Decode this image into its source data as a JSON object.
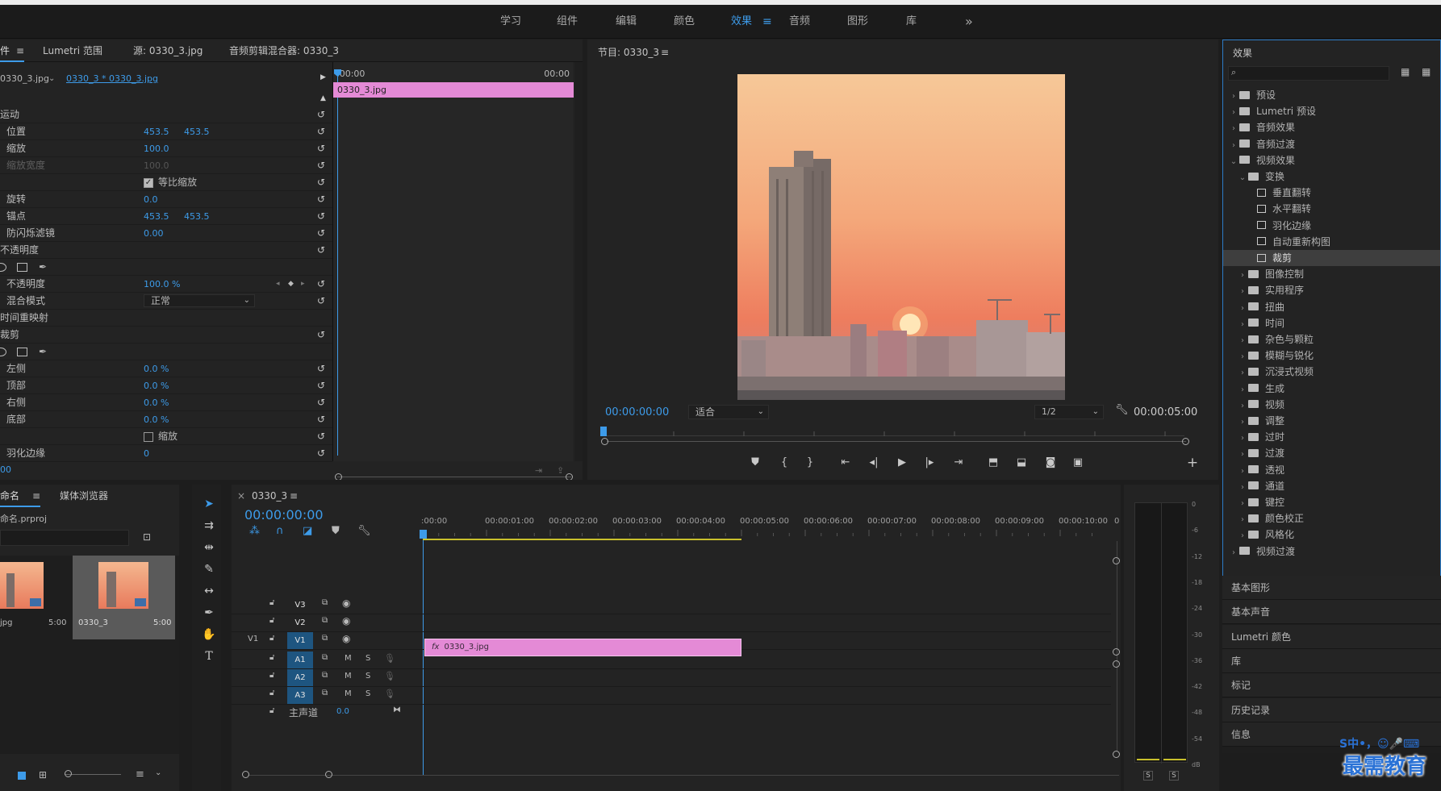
{
  "workspace_tabs": [
    {
      "label": "学习",
      "active": false
    },
    {
      "label": "组件",
      "active": false
    },
    {
      "label": "编辑",
      "active": false
    },
    {
      "label": "颜色",
      "active": false
    },
    {
      "label": "效果",
      "active": true
    },
    {
      "label": "音频",
      "active": false
    },
    {
      "label": "图形",
      "active": false
    },
    {
      "label": "库",
      "active": false
    }
  ],
  "workspace_more": "»",
  "effect_controls": {
    "tab_partial": "件",
    "tabs": [
      "Lumetri 范围",
      "源: 0330_3.jpg",
      "音频剪辑混合器: 0330_3"
    ],
    "source_clip": "0330_3.jpg",
    "sequence_clip": "0330_3 * 0330_3.jpg",
    "timecode_start": ":00:00",
    "timecode_end": "00:00",
    "clip_bar_label": "0330_3.jpg",
    "bottom_timecode": "00",
    "rows": [
      {
        "label": "运动",
        "v1": "",
        "v2": "",
        "indent": 0
      },
      {
        "label": "位置",
        "v1": "453.5",
        "v2": "453.5",
        "indent": 1
      },
      {
        "label": "缩放",
        "v1": "100.0",
        "v2": "",
        "indent": 1
      },
      {
        "label": "缩放宽度",
        "v1": "100.0",
        "v2": "",
        "indent": 1,
        "dim": true
      },
      {
        "label": "",
        "v1": "",
        "v2": "",
        "indent": 1,
        "checkbox": "等比缩放",
        "checked": true
      },
      {
        "label": "旋转",
        "v1": "0.0",
        "v2": "",
        "indent": 1
      },
      {
        "label": "锚点",
        "v1": "453.5",
        "v2": "453.5",
        "indent": 1
      },
      {
        "label": "防闪烁滤镜",
        "v1": "0.00",
        "v2": "",
        "indent": 1
      },
      {
        "label": "不透明度",
        "v1": "",
        "v2": "",
        "indent": 0
      },
      {
        "label": "",
        "v1": "",
        "v2": "",
        "indent": 0,
        "shapes": true
      },
      {
        "label": "不透明度",
        "v1": "100.0 %",
        "v2": "",
        "indent": 1,
        "keyframe": true
      },
      {
        "label": "混合模式",
        "v1": "",
        "v2": "",
        "indent": 1,
        "select": "正常"
      },
      {
        "label": "时间重映射",
        "v1": "",
        "v2": "",
        "indent": 0
      },
      {
        "label": "裁剪",
        "v1": "",
        "v2": "",
        "indent": 0
      },
      {
        "label": "",
        "v1": "",
        "v2": "",
        "indent": 0,
        "shapes": true
      },
      {
        "label": "左侧",
        "v1": "0.0 %",
        "v2": "",
        "indent": 1
      },
      {
        "label": "顶部",
        "v1": "0.0 %",
        "v2": "",
        "indent": 1
      },
      {
        "label": "右侧",
        "v1": "0.0 %",
        "v2": "",
        "indent": 1
      },
      {
        "label": "底部",
        "v1": "0.0 %",
        "v2": "",
        "indent": 1
      },
      {
        "label": "",
        "v1": "",
        "v2": "",
        "indent": 1,
        "checkbox": "缩放",
        "checked": false
      },
      {
        "label": "羽化边缘",
        "v1": "0",
        "v2": "",
        "indent": 1
      }
    ]
  },
  "program_monitor": {
    "title": "节目: 0330_3",
    "timecode": "00:00:00:00",
    "fit": "适合",
    "quality": "1/2",
    "duration": "00:00:05:00"
  },
  "effects_panel": {
    "title": "效果",
    "search_placeholder": "",
    "items": [
      {
        "label": "预设",
        "level": 0,
        "type": "folder",
        "open": false
      },
      {
        "label": "Lumetri 预设",
        "level": 0,
        "type": "folder",
        "open": false
      },
      {
        "label": "音频效果",
        "level": 0,
        "type": "folder",
        "open": false
      },
      {
        "label": "音频过渡",
        "level": 0,
        "type": "folder",
        "open": false
      },
      {
        "label": "视频效果",
        "level": 0,
        "type": "folder",
        "open": true
      },
      {
        "label": "变换",
        "level": 1,
        "type": "folder",
        "open": true
      },
      {
        "label": "垂直翻转",
        "level": 2,
        "type": "effect"
      },
      {
        "label": "水平翻转",
        "level": 2,
        "type": "effect"
      },
      {
        "label": "羽化边缘",
        "level": 2,
        "type": "effect"
      },
      {
        "label": "自动重新构图",
        "level": 2,
        "type": "effect"
      },
      {
        "label": "裁剪",
        "level": 2,
        "type": "effect",
        "selected": true
      },
      {
        "label": "图像控制",
        "level": 1,
        "type": "folder",
        "open": false
      },
      {
        "label": "实用程序",
        "level": 1,
        "type": "folder",
        "open": false
      },
      {
        "label": "扭曲",
        "level": 1,
        "type": "folder",
        "open": false
      },
      {
        "label": "时间",
        "level": 1,
        "type": "folder",
        "open": false
      },
      {
        "label": "杂色与颗粒",
        "level": 1,
        "type": "folder",
        "open": false
      },
      {
        "label": "模糊与锐化",
        "level": 1,
        "type": "folder",
        "open": false
      },
      {
        "label": "沉浸式视频",
        "level": 1,
        "type": "folder",
        "open": false
      },
      {
        "label": "生成",
        "level": 1,
        "type": "folder",
        "open": false
      },
      {
        "label": "视频",
        "level": 1,
        "type": "folder",
        "open": false
      },
      {
        "label": "调整",
        "level": 1,
        "type": "folder",
        "open": false
      },
      {
        "label": "过时",
        "level": 1,
        "type": "folder",
        "open": false
      },
      {
        "label": "过渡",
        "level": 1,
        "type": "folder",
        "open": false
      },
      {
        "label": "透视",
        "level": 1,
        "type": "folder",
        "open": false
      },
      {
        "label": "通道",
        "level": 1,
        "type": "folder",
        "open": false
      },
      {
        "label": "键控",
        "level": 1,
        "type": "folder",
        "open": false
      },
      {
        "label": "颜色校正",
        "level": 1,
        "type": "folder",
        "open": false
      },
      {
        "label": "风格化",
        "level": 1,
        "type": "folder",
        "open": false
      },
      {
        "label": "视频过渡",
        "level": 0,
        "type": "folder",
        "open": false
      }
    ]
  },
  "lower_panels": [
    "基本图形",
    "基本声音",
    "Lumetri 颜色",
    "库",
    "标记",
    "历史记录",
    "信息"
  ],
  "project_panel": {
    "tab_partial": "命名",
    "tab2": "媒体浏览器",
    "project_file": "命名.prproj",
    "items": [
      {
        "name": "jpg",
        "duration": "5:00"
      },
      {
        "name": "0330_3",
        "duration": "5:00"
      }
    ]
  },
  "timeline": {
    "sequence": "0330_3",
    "timecode": "00:00:00:00",
    "ruler": [
      ":00:00",
      "00:00:01:00",
      "00:00:02:00",
      "00:00:03:00",
      "00:00:04:00",
      "00:00:05:00",
      "00:00:06:00",
      "00:00:07:00",
      "00:00:08:00",
      "00:00:09:00",
      "00:00:10:00",
      "0"
    ],
    "video_tracks": [
      "V3",
      "V2",
      "V1"
    ],
    "audio_tracks": [
      "A1",
      "A2",
      "A3"
    ],
    "v1_source": "V1",
    "master_label": "主声道",
    "master_value": "0.0",
    "clip_label": "0330_3.jpg",
    "mute": "M",
    "solo": "S"
  },
  "audio_meter": {
    "scale": [
      "0",
      "-6",
      "-12",
      "-18",
      "-24",
      "-30",
      "-36",
      "-42",
      "-48",
      "-54",
      "dB"
    ],
    "solo_left": "S",
    "solo_right": "S"
  },
  "watermark": {
    "text": "最需教育",
    "ime": "S中•，☺🎤⌨"
  },
  "colors": {
    "accent": "#3d9be9",
    "clip_pink": "#e48ad6",
    "track_blue": "#1e5580",
    "work_area": "#c9c02c"
  }
}
